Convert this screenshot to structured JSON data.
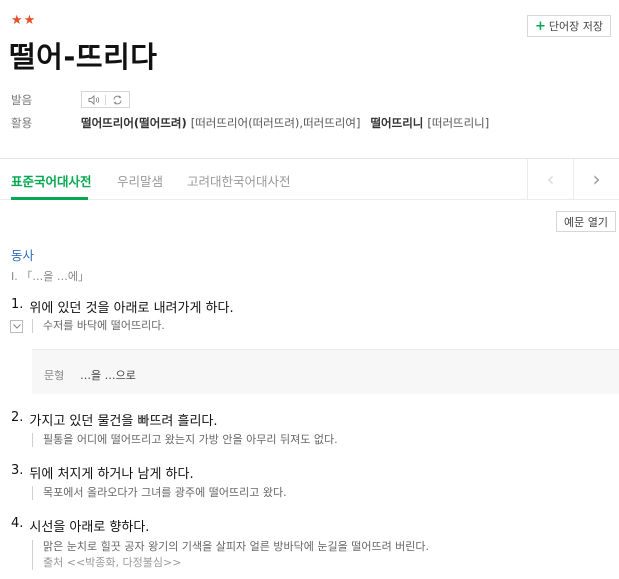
{
  "entry": {
    "stars": "★★",
    "headword": "떨어-뜨리다",
    "save_button": "단어장 저장",
    "pronunciation_label": "발음",
    "conjugation_label": "활용",
    "conjugations": [
      {
        "form": "떨어뜨리어(떨어뜨려)",
        "pron": "[떠러뜨리어(떠러뜨려),떠러뜨리여]"
      },
      {
        "form": "떨어뜨리니",
        "pron": "[떠러뜨리니]"
      }
    ]
  },
  "tabs": {
    "items": [
      {
        "label": "표준국어대사전"
      },
      {
        "label": "우리말샘"
      },
      {
        "label": "고려대한국어대사전"
      }
    ],
    "prev": "‹",
    "next": "›"
  },
  "example_toggle": "예문 열기",
  "definition": {
    "pos": "동사",
    "pattern": "I. 「…을 …에」",
    "senses": [
      {
        "num": "1.",
        "text": "위에 있던 것을 아래로 내려가게 하다.",
        "example": "수저를 바닥에 떨어뜨리다."
      },
      {
        "num": "2.",
        "text": "가지고 있던 물건을 빠뜨려 흘리다.",
        "example": "필통을 어디에 떨어뜨리고 왔는지 가방 안을 아무리 뒤져도 없다."
      },
      {
        "num": "3.",
        "text": "뒤에 처지게 하거나 남게 하다.",
        "example": "목포에서 올라오다가 그녀를 광주에 떨어뜨리고 왔다."
      },
      {
        "num": "4.",
        "text": "시선을 아래로 향하다.",
        "example": "맑은 눈치로 힐끗 공자 왕기의 기색을 살피자 얼른 방바닥에 눈길을 떨어뜨려 버린다.",
        "source": "출처 <<박종화, 다정불심>>"
      }
    ],
    "grammar_label": "문형",
    "grammar_value": "…을 …으로"
  }
}
